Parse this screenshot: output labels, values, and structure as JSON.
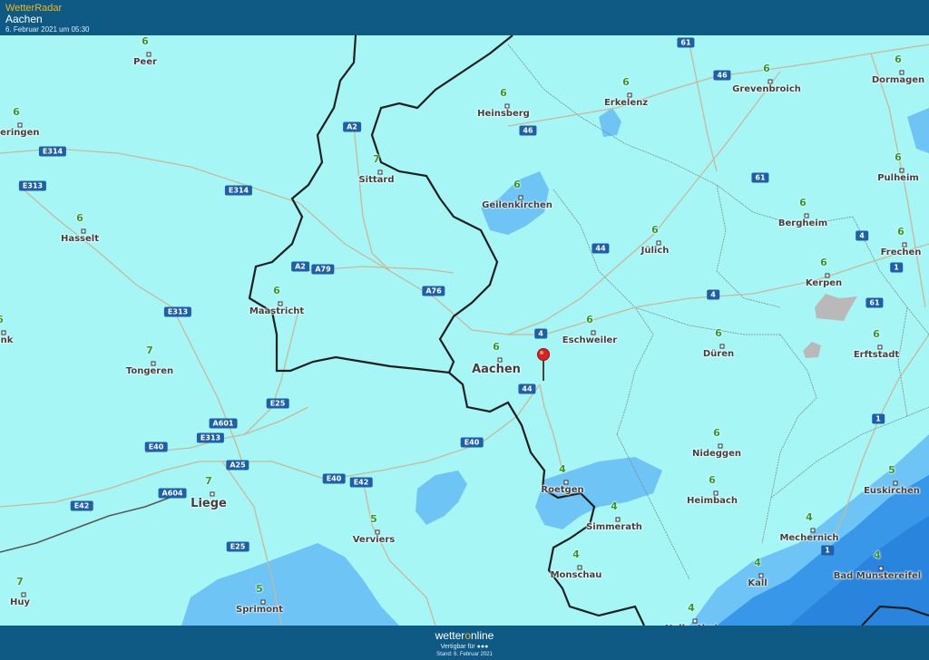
{
  "header": {
    "app_name": "WetterRadar",
    "location": "Aachen",
    "timestamp": "6. Februar 2021 um 05:30"
  },
  "footer": {
    "brand_prefix": "wetter",
    "brand_o": "o",
    "brand_suffix": "nline",
    "validity": "Vertigbar für ●●●",
    "stand": "Stand: 6. Februar 2021"
  },
  "colors": {
    "background": "#a7f6f6",
    "rain_light": "#6ec4f5",
    "rain_medium": "#2f8fe6",
    "header": "#0e5a85",
    "temp_text": "#2e9b2e",
    "road_badge": "#1f5fa8"
  },
  "cities": [
    {
      "name": "Peer",
      "temp": "6"
    },
    {
      "name": "Heinsberg",
      "temp": "6"
    },
    {
      "name": "Erkelenz",
      "temp": "6"
    },
    {
      "name": "Grevenbroich",
      "temp": "6"
    },
    {
      "name": "Dormagen",
      "temp": "6"
    },
    {
      "name": "Beringen",
      "temp": "6"
    },
    {
      "name": "Sittard",
      "temp": "7"
    },
    {
      "name": "Geilenkirchen",
      "temp": "6"
    },
    {
      "name": "Pulheim",
      "temp": "6"
    },
    {
      "name": "Hasselt",
      "temp": "6"
    },
    {
      "name": "Jülich",
      "temp": "6"
    },
    {
      "name": "Bergheim",
      "temp": "6"
    },
    {
      "name": "Frechen",
      "temp": "6"
    },
    {
      "name": "Kerpen",
      "temp": "6"
    },
    {
      "name": "Maastricht",
      "temp": "6"
    },
    {
      "name": "Eschweiler",
      "temp": "6"
    },
    {
      "name": "Düren",
      "temp": "6"
    },
    {
      "name": "Erftstadt",
      "temp": "6"
    },
    {
      "name": "Genk",
      "temp": "6"
    },
    {
      "name": "Aachen",
      "temp": "6"
    },
    {
      "name": "Tongeren",
      "temp": "7"
    },
    {
      "name": "Nideggen",
      "temp": "6"
    },
    {
      "name": "Euskirchen",
      "temp": "5"
    },
    {
      "name": "Roetgen",
      "temp": "4"
    },
    {
      "name": "Heimbach",
      "temp": "6"
    },
    {
      "name": "Liege",
      "temp": "7"
    },
    {
      "name": "Simmerath",
      "temp": "4"
    },
    {
      "name": "Verviers",
      "temp": "5"
    },
    {
      "name": "Mechernich",
      "temp": "4"
    },
    {
      "name": "Monschau",
      "temp": "4"
    },
    {
      "name": "Bad Münstereifel",
      "temp": "4"
    },
    {
      "name": "Kall",
      "temp": "4"
    },
    {
      "name": "Huy",
      "temp": "7"
    },
    {
      "name": "Sprimont",
      "temp": "5"
    },
    {
      "name": "Hellenthal",
      "temp": "4"
    }
  ],
  "roads": [
    "61",
    "46",
    "46",
    "A2",
    "E314",
    "E313",
    "E314",
    "A2",
    "A79",
    "A76",
    "E313",
    "44",
    "61",
    "4",
    "4",
    "1",
    "61",
    "4",
    "E25",
    "A601",
    "E313",
    "44",
    "E40",
    "E40",
    "A25",
    "E40",
    "E42",
    "A604",
    "E42",
    "E25",
    "1",
    "1"
  ]
}
